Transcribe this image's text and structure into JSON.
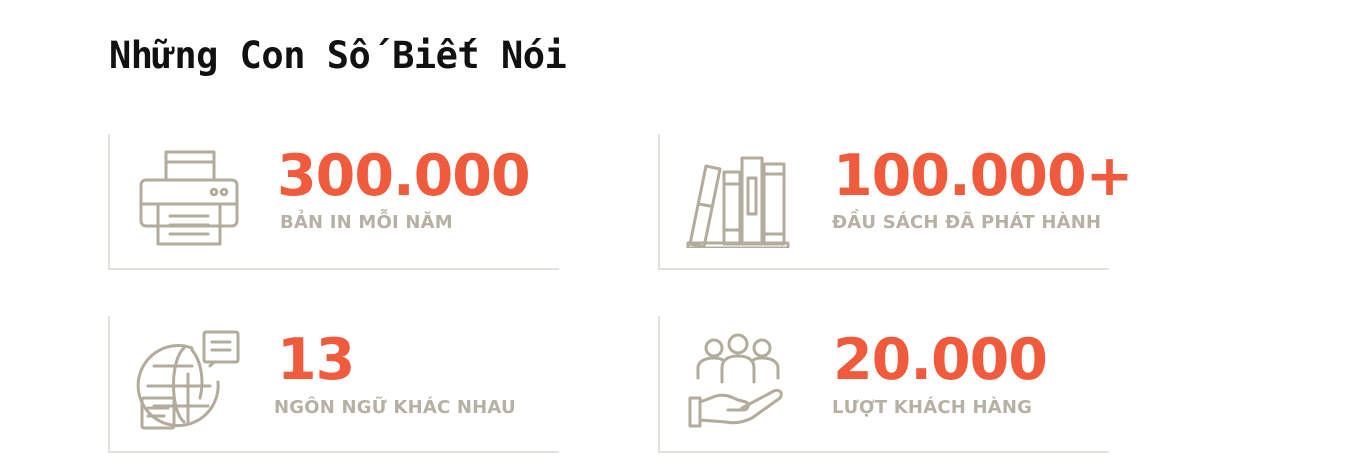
{
  "section": {
    "title": "Những Con Số Biết Nói"
  },
  "stats": [
    {
      "value": "300.000",
      "label": "BẢN IN MỖI NĂM",
      "icon": "printer-icon"
    },
    {
      "value": "100.000+",
      "label": "ĐẦU SÁCH ĐÃ PHÁT HÀNH",
      "icon": "books-icon"
    },
    {
      "value": "13",
      "label": "NGÔN NGỮ KHÁC NHAU",
      "icon": "globe-chat-icon"
    },
    {
      "value": "20.000",
      "label": "LƯỢT KHÁCH HÀNG",
      "icon": "customers-hand-icon"
    }
  ],
  "colors": {
    "accent": "#ef5b3c",
    "label": "#b7b0a4",
    "icon_stroke": "#b3ab9c",
    "divider": "#e4e1dc",
    "title": "#111111"
  }
}
